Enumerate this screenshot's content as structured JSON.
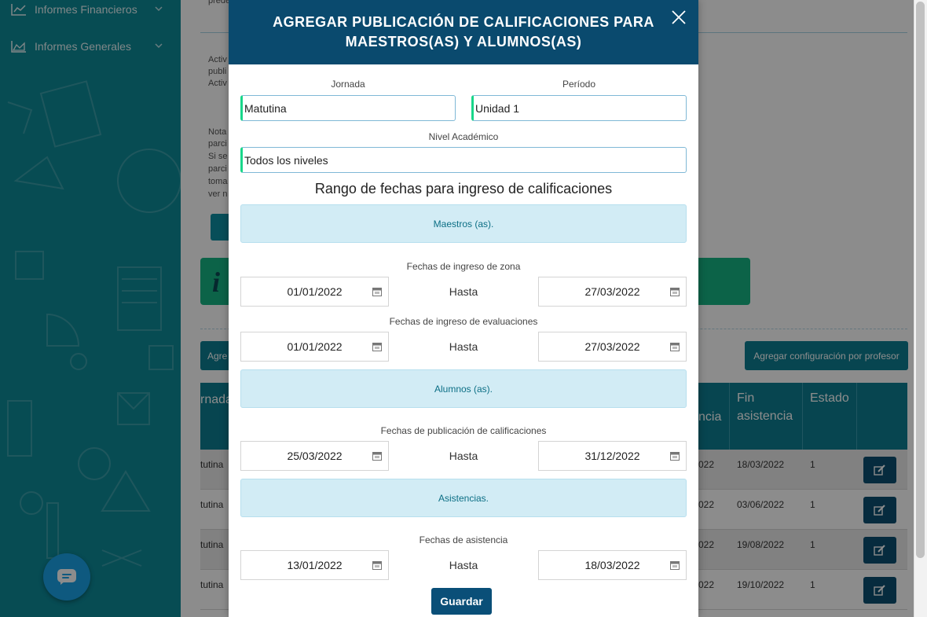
{
  "sidebar": {
    "items": [
      {
        "label": "Informes Financieros",
        "icon": "line-chart-icon"
      },
      {
        "label": "Informes Generales",
        "icon": "area-chart-icon"
      }
    ],
    "chat_icon": "chat-bubble-icon"
  },
  "background": {
    "text_top": "prede",
    "text_block1": [
      "Activ",
      "publi",
      "Activ"
    ],
    "text_block2": [
      "Nota",
      "parci",
      "Si se",
      "parci",
      "toma",
      "ver n"
    ],
    "button_partial": "Agre",
    "button_per_teacher": "Agregar configuración por profesor",
    "table": {
      "headers": [
        "rnada",
        "ncia",
        "Fin asistencia",
        "Estado"
      ],
      "rows": [
        {
          "jornada": "tutina",
          "asistencia": "022",
          "fin": "18/03/2022",
          "estado": "1"
        },
        {
          "jornada": "tutina",
          "asistencia": "022",
          "fin": "03/06/2022",
          "estado": "1"
        },
        {
          "jornada": "tutina",
          "asistencia": "022",
          "fin": "19/08/2022",
          "estado": "1"
        },
        {
          "jornada": "tutina",
          "asistencia": "022",
          "fin": "19/10/2022",
          "estado": "1"
        }
      ],
      "edit_icon": "edit-icon"
    }
  },
  "modal": {
    "title": "AGREGAR PUBLICACIÓN DE CALIFICACIONES PARA MAESTROS(AS) Y ALUMNOS(AS)",
    "close_icon": "close-icon",
    "jornada_label": "Jornada",
    "jornada_value": "Matutina",
    "periodo_label": "Período",
    "periodo_value": "Unidad 1",
    "nivel_label": "Nivel Académico",
    "nivel_value": "Todos los niveles",
    "range_title": "Rango de fechas para ingreso de calificaciones",
    "sections": {
      "maestros": "Maestros (as).",
      "alumnos": "Alumnos (as).",
      "asistencias": "Asistencias."
    },
    "date_rows": [
      {
        "label": "Fechas de ingreso de zona",
        "from": "01/01/2022",
        "to": "27/03/2022"
      },
      {
        "label": "Fechas de ingreso de evaluaciones",
        "from": "01/01/2022",
        "to": "27/03/2022"
      },
      {
        "label": "Fechas de publicación de calificaciones",
        "from": "25/03/2022",
        "to": "31/12/2022"
      },
      {
        "label": "Fechas de asistencia",
        "from": "13/01/2022",
        "to": "18/03/2022"
      }
    ],
    "hasta_label": "Hasta",
    "calendar_icon": "calendar-icon",
    "save_label": "Guardar"
  },
  "colors": {
    "sidebar": "#0d8a98",
    "modal_header": "#0a4a6e",
    "input_accent": "#19d68a",
    "info_box": "#d2ecf5",
    "save_button": "#0a4f78"
  }
}
